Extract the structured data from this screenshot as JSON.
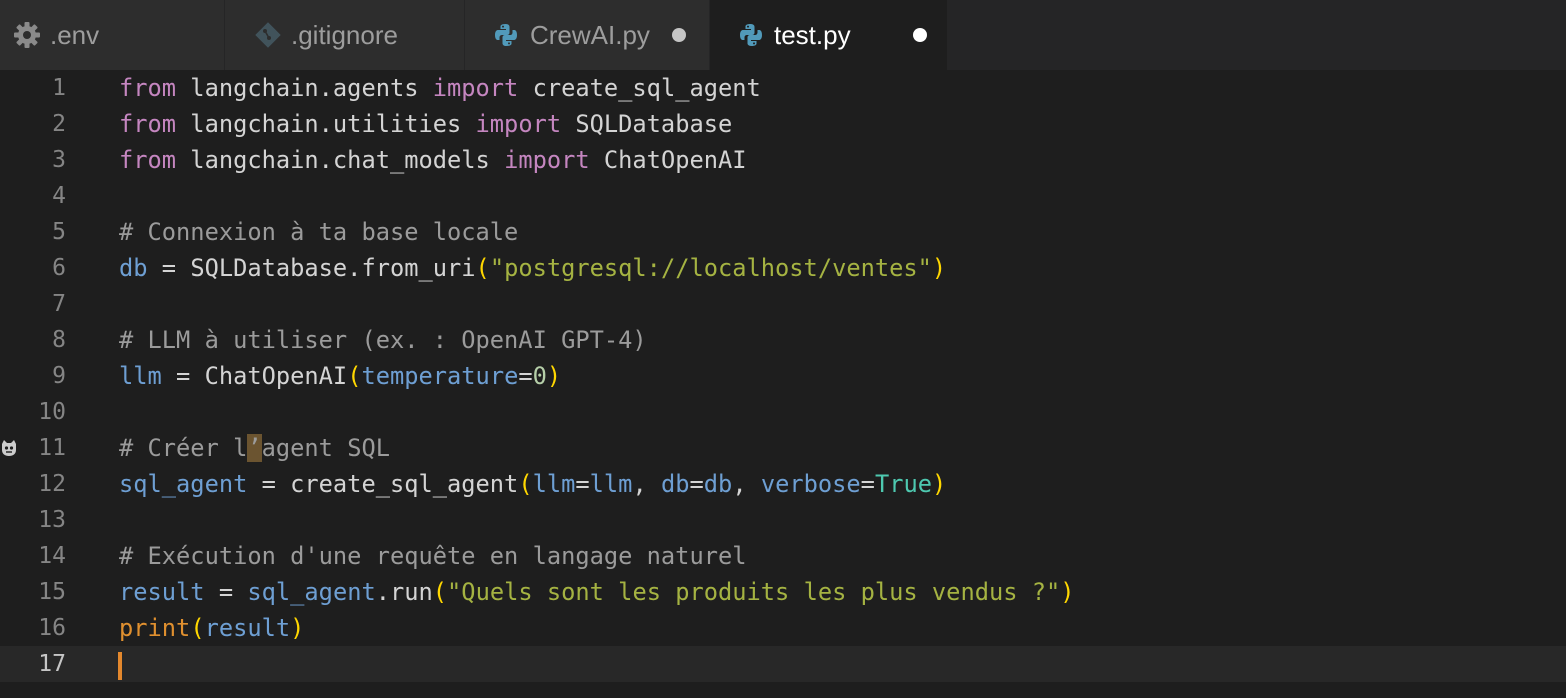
{
  "tabs": [
    {
      "label": ".env",
      "icon": "gear-icon",
      "dirty": false,
      "active": false
    },
    {
      "label": ".gitignore",
      "icon": "git-diamond-icon",
      "dirty": false,
      "active": false
    },
    {
      "label": "CrewAI.py",
      "icon": "python-icon",
      "dirty": true,
      "active": false
    },
    {
      "label": "test.py",
      "icon": "python-icon",
      "dirty": true,
      "active": true
    }
  ],
  "editor": {
    "language": "python",
    "current_line": 17,
    "lines": [
      {
        "n": "1",
        "text": "from langchain.agents import create_sql_agent"
      },
      {
        "n": "2",
        "text": "from langchain.utilities import SQLDatabase"
      },
      {
        "n": "3",
        "text": "from langchain.chat_models import ChatOpenAI"
      },
      {
        "n": "4",
        "text": ""
      },
      {
        "n": "5",
        "text": "# Connexion à ta base locale"
      },
      {
        "n": "6",
        "text": "db = SQLDatabase.from_uri(\"postgresql://localhost/ventes\")"
      },
      {
        "n": "7",
        "text": ""
      },
      {
        "n": "8",
        "text": "# LLM à utiliser (ex. : OpenAI GPT-4)"
      },
      {
        "n": "9",
        "text": "llm = ChatOpenAI(temperature=0)"
      },
      {
        "n": "10",
        "text": ""
      },
      {
        "n": "11",
        "text": "# Créer l’agent SQL"
      },
      {
        "n": "12",
        "text": "sql_agent = create_sql_agent(llm=llm, db=db, verbose=True)"
      },
      {
        "n": "13",
        "text": ""
      },
      {
        "n": "14",
        "text": "# Exécution d'une requête en langage naturel"
      },
      {
        "n": "15",
        "text": "result = sql_agent.run(\"Quels sont les produits les plus vendus ?\")"
      },
      {
        "n": "16",
        "text": "print(result)"
      },
      {
        "n": "17",
        "text": ""
      }
    ]
  },
  "colors": {
    "keyword": "#c586c0",
    "comment": "#9b9b9b",
    "string": "#a5b342",
    "bracket": "#ffd700",
    "variable": "#6e9fd3",
    "builtin": "#e0902f",
    "boolean": "#4ec9b0",
    "cursor": "#e3882d"
  }
}
